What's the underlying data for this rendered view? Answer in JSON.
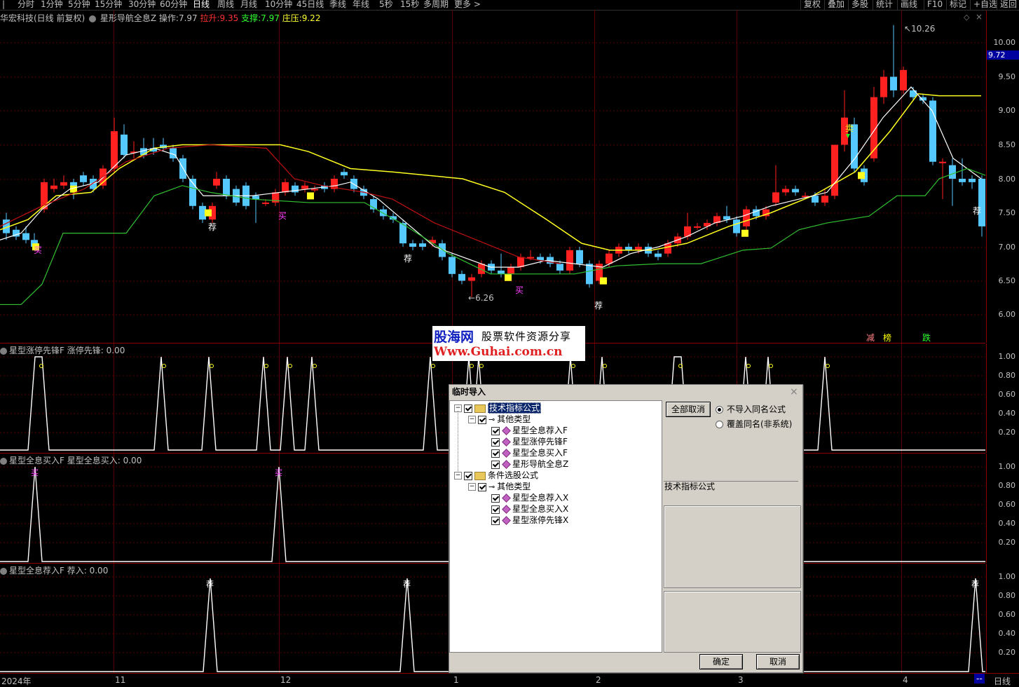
{
  "toolbar": {
    "periods": [
      "分时",
      "1分钟",
      "5分钟",
      "15分钟",
      "30分钟",
      "60分钟",
      "日线",
      "周线",
      "月线",
      "10分钟",
      "45日线",
      "季线",
      "年线",
      "5秒",
      "15秒",
      "多周期",
      "更多 >"
    ],
    "active": "日线",
    "right": [
      "复权",
      "叠加",
      "多股",
      "统计",
      "画线",
      "F10",
      "标记",
      "+自选",
      "返回"
    ]
  },
  "main": {
    "stock": "华宏科技(日线 前复权)",
    "indicator": "星形导航全息Z",
    "op_label": "操作:",
    "op_value": "7.97",
    "pull_label": "拉升:",
    "pull_value": "9.35",
    "support_label": "支撑:",
    "support_value": "7.97",
    "press_label": "庄压:",
    "press_value": "9.22",
    "price_ticks": [
      "10.00",
      "9.50",
      "9.00",
      "8.50",
      "8.00",
      "7.50",
      "7.00",
      "6.50",
      "6.00"
    ],
    "current_price": "9.72",
    "high_label": "10.26",
    "low_label": "6.26",
    "marks": {
      "buy": "买",
      "sell": "卖",
      "recommend": "荐",
      "reduce": "减",
      "watch": "榜",
      "fall": "跌"
    }
  },
  "watermark": {
    "site": "股海网",
    "slogan": "股票软件资源分享",
    "url": "Www.Guhai.com.cn"
  },
  "panel1": {
    "name": "星型涨停先锋F",
    "label": "涨停先锋:",
    "value": "0.00",
    "ticks": [
      "1.00",
      "0.80",
      "0.60",
      "0.40",
      "0.20"
    ]
  },
  "panel2": {
    "name": "星型全息买入F",
    "label": "星型全息买入:",
    "value": "0.00",
    "ticks": [
      "1.00",
      "0.80",
      "0.60",
      "0.40",
      "0.20"
    ],
    "mark": "买"
  },
  "panel3": {
    "name": "星型全息荐入F",
    "label": "荐入:",
    "value": "0.00",
    "ticks": [
      "1.00",
      "0.80",
      "0.60",
      "0.40",
      "0.20"
    ],
    "mark": "荐"
  },
  "timeaxis": {
    "labels": [
      "2024年",
      "11",
      "12",
      "1",
      "2",
      "3",
      "4"
    ],
    "period": "日线",
    "indicator": "--"
  },
  "dialog": {
    "title": "临时导入",
    "tree": [
      {
        "label": "技术指标公式",
        "level": 0,
        "type": "folder",
        "selected": true
      },
      {
        "label": "其他类型",
        "level": 1,
        "type": "key"
      },
      {
        "label": "星型全息荐入F",
        "level": 2,
        "type": "item"
      },
      {
        "label": "星型涨停先锋F",
        "level": 2,
        "type": "item"
      },
      {
        "label": "星型全息买入F",
        "level": 2,
        "type": "item"
      },
      {
        "label": "星形导航全息Z",
        "level": 2,
        "type": "item"
      },
      {
        "label": "条件选股公式",
        "level": 0,
        "type": "folder"
      },
      {
        "label": "其他类型",
        "level": 1,
        "type": "key"
      },
      {
        "label": "星型全息荐入X",
        "level": 2,
        "type": "item"
      },
      {
        "label": "星型全息买入X",
        "level": 2,
        "type": "item"
      },
      {
        "label": "星型涨停先锋X",
        "level": 2,
        "type": "item"
      }
    ],
    "cancel_all": "全部取消",
    "radio1": "不导入同名公式",
    "radio2": "覆盖同名(非系统)",
    "section_label": "技术指标公式",
    "ok": "确定",
    "cancel": "取消"
  }
}
